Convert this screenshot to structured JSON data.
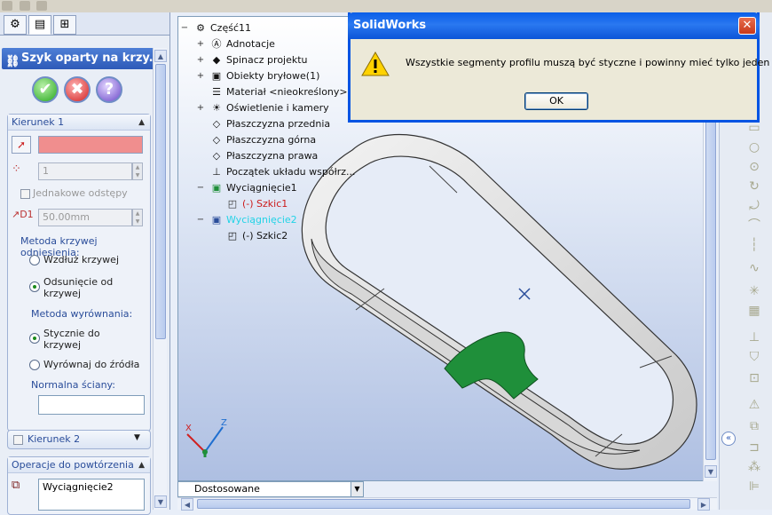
{
  "property_manager": {
    "title": "Szyk oparty na krzy...",
    "kierunek1": {
      "header": "Kierunek 1",
      "count_value": "1",
      "equal_spacing_label": "Jednakowe odstępy",
      "distance_value": "50.00mm",
      "curve_method_label": "Metoda krzywej odniesienia:",
      "along_curve_label": "Wzdłuż krzywej",
      "offset_curve_label_1": "Odsunięcie od",
      "offset_curve_label_2": "krzywej",
      "alignment_method_label": "Metoda wyrównania:",
      "tangent_label_1": "Stycznie do",
      "tangent_label_2": "krzywej",
      "align_source_label": "Wyrównaj do źródła",
      "face_normal_label": "Normalna ściany:"
    },
    "kierunek2": {
      "header": "Kierunek 2"
    },
    "features": {
      "header": "Operacje do powtórzenia",
      "item": "Wyciągnięcie2"
    }
  },
  "tree": {
    "root": "Część11",
    "items": [
      "Adnotacje",
      "Spinacz projektu",
      "Obiekty bryłowe(1)",
      "Materiał <nieokreślony>",
      "Oświetlenie i kamery",
      "Płaszczyzna przednia",
      "Płaszczyzna górna",
      "Płaszczyzna prawa",
      "Początek układu współrz...",
      "Wyciągnięcie1",
      "(-) Szkic1",
      "Wyciągnięcie2",
      "(-) Szkic2"
    ]
  },
  "view_combo": "Dostosowane",
  "dialog": {
    "title": "SolidWorks",
    "message": "Wszystkie segmenty profilu muszą być styczne i powinny mieć tylko jeden kontur.",
    "ok_label": "OK"
  },
  "colors": {
    "selection_field": "#f08e8e",
    "model_green": "#1f8f3a",
    "sketch_red": "#cc1b1b",
    "highlight_cyan": "#22d3e6"
  }
}
